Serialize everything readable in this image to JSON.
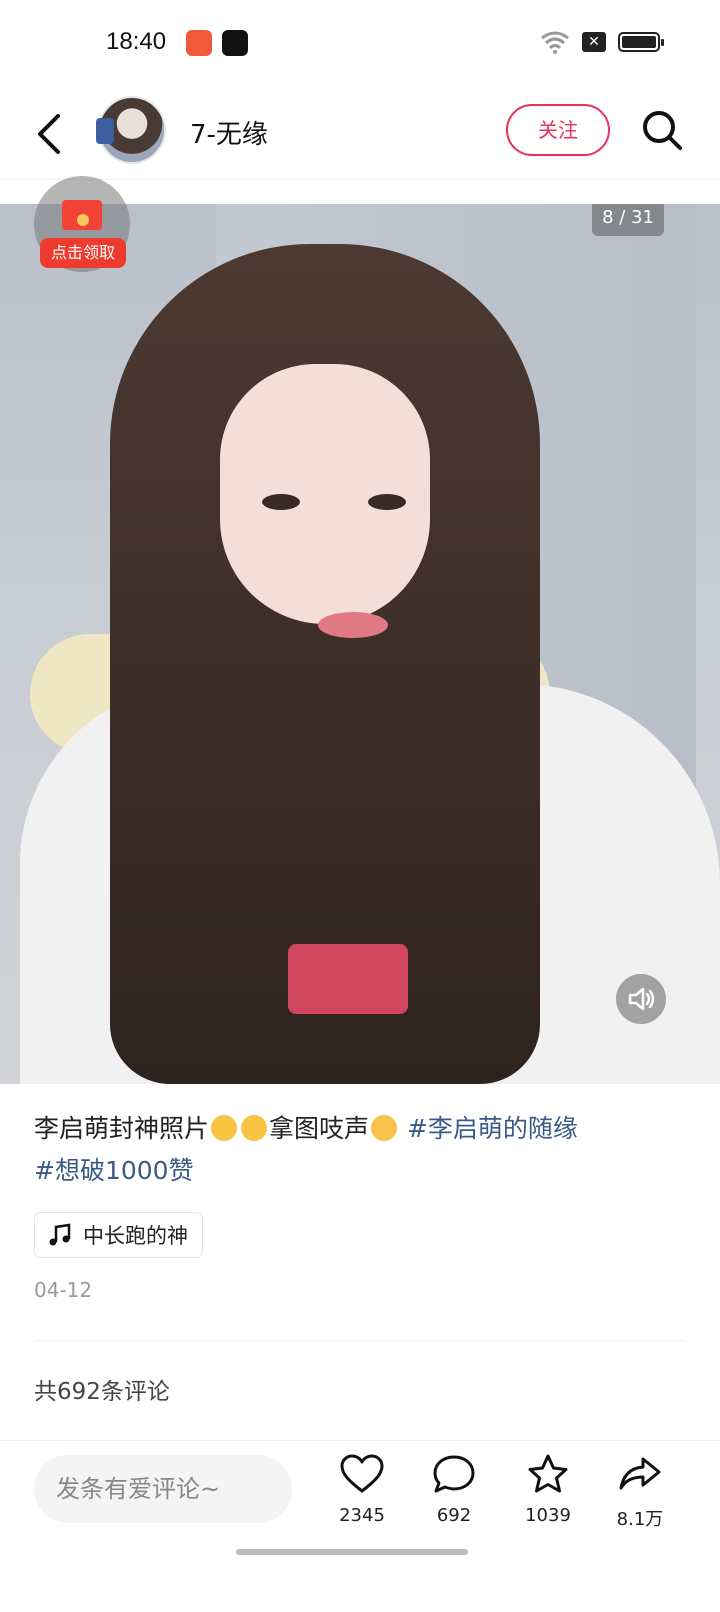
{
  "status_bar": {
    "time": "18:40"
  },
  "header": {
    "username": "7-无缘",
    "follow_label": "关注"
  },
  "photo": {
    "counter": "8 / 31",
    "redpacket_label": "点击领取"
  },
  "post": {
    "caption_text": "李启萌封神照片",
    "caption_text2": "拿图吱声",
    "hashtag1": "#李启萌的随缘",
    "hashtag2": "#想破1000赞",
    "music": "中长跑的神",
    "date": "04-12",
    "comments_count": "共692条评论"
  },
  "bottom_bar": {
    "comment_placeholder": "发条有爱评论~",
    "like_count": "2345",
    "comment_count": "692",
    "favorite_count": "1039",
    "share_count": "8.1万"
  },
  "colors": {
    "accent": "#e8325c",
    "hashtag": "#3b5a86"
  }
}
